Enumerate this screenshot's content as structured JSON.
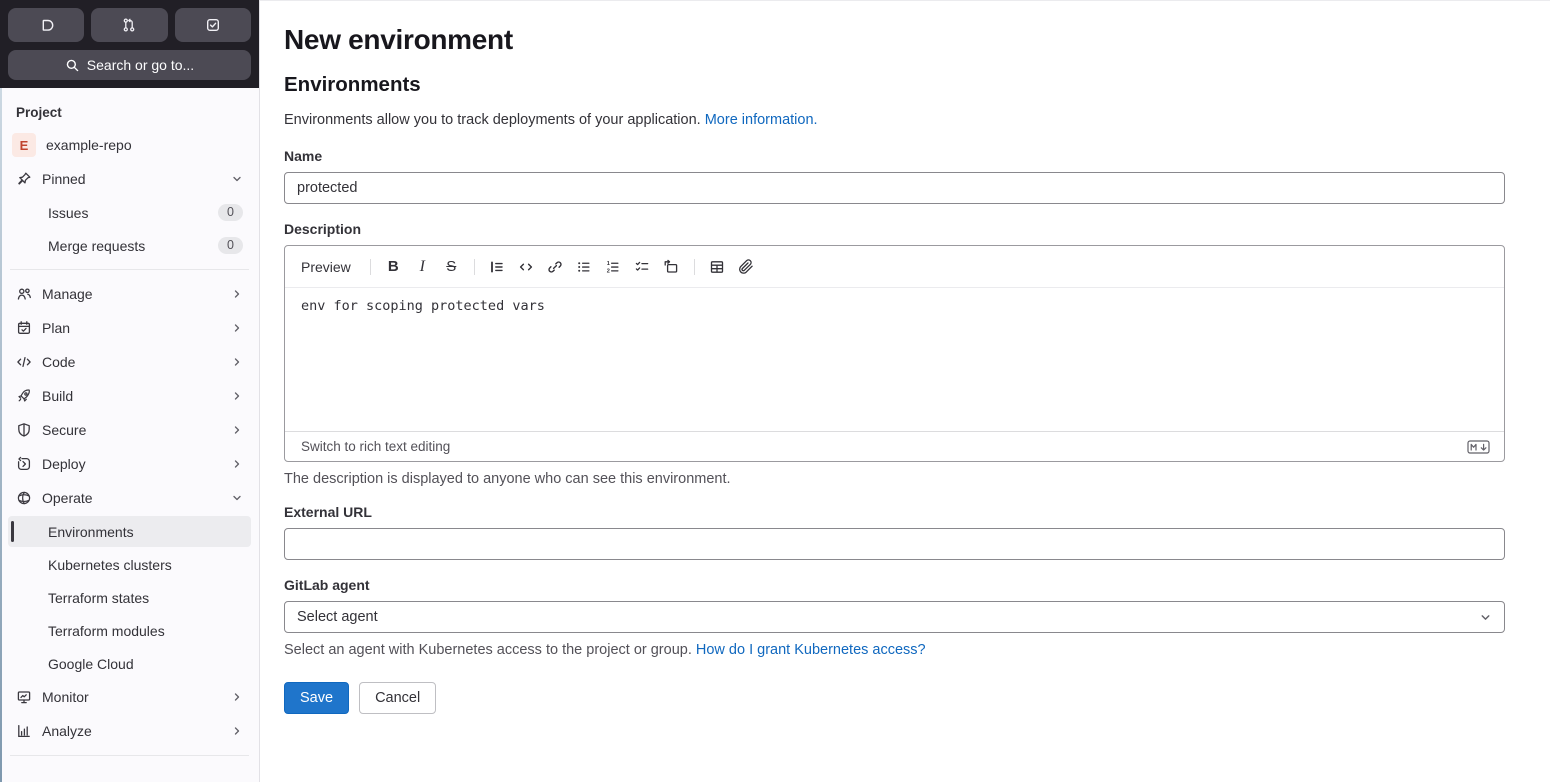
{
  "colors": {
    "header_dark": "#211f26",
    "header_button": "#4c4a54",
    "sidebar_bg": "#fbfafd",
    "active_item_bg": "#ececef",
    "link_blue": "#1068bf",
    "primary_button": "#1f75cb",
    "avatar_bg": "#fbe9e4",
    "avatar_text": "#c0452f"
  },
  "sidebar": {
    "search": {
      "label": "Search or go to..."
    },
    "section_label": "Project",
    "project": {
      "avatar_letter": "E",
      "name": "example-repo"
    },
    "pinned": {
      "label": "Pinned",
      "items": [
        {
          "label": "Issues",
          "badge": "0"
        },
        {
          "label": "Merge requests",
          "badge": "0"
        }
      ]
    },
    "nav_items": [
      {
        "label": "Manage"
      },
      {
        "label": "Plan"
      },
      {
        "label": "Code"
      },
      {
        "label": "Build"
      },
      {
        "label": "Secure"
      },
      {
        "label": "Deploy"
      },
      {
        "label": "Operate"
      }
    ],
    "operate_children": [
      {
        "label": "Environments",
        "active": true
      },
      {
        "label": "Kubernetes clusters"
      },
      {
        "label": "Terraform states"
      },
      {
        "label": "Terraform modules"
      },
      {
        "label": "Google Cloud"
      }
    ],
    "bottom_items": [
      {
        "label": "Monitor"
      },
      {
        "label": "Analyze"
      }
    ]
  },
  "main": {
    "page_title": "New environment",
    "section_title": "Environments",
    "intro_text": "Environments allow you to track deployments of your application. ",
    "intro_link": "More information.",
    "name_field": {
      "label": "Name",
      "value": "protected"
    },
    "description_field": {
      "label": "Description",
      "preview_label": "Preview",
      "value": "env for scoping protected vars",
      "footer_link": "Switch to rich text editing",
      "help": "The description is displayed to anyone who can see this environment."
    },
    "external_url_field": {
      "label": "External URL",
      "value": ""
    },
    "agent_field": {
      "label": "GitLab agent",
      "value": "Select agent",
      "help": "Select an agent with Kubernetes access to the project or group. ",
      "help_link": "How do I grant Kubernetes access?"
    },
    "actions": {
      "save": "Save",
      "cancel": "Cancel"
    }
  }
}
